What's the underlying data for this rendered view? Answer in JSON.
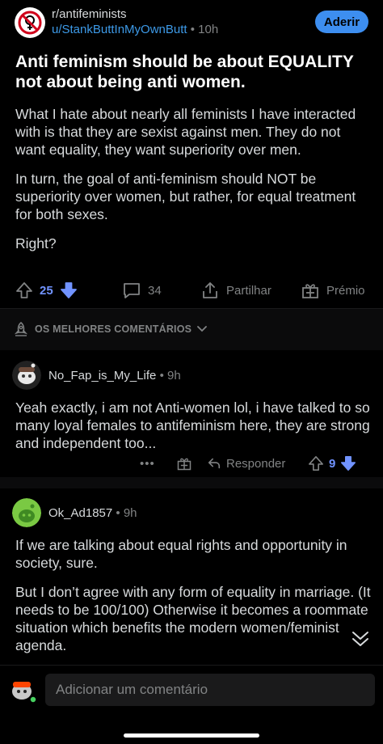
{
  "header": {
    "subreddit": "r/antifeminists",
    "author": "u/StankButtInMyOwnButt",
    "separator": " • ",
    "age": "10h",
    "join_label": "Aderir",
    "sub_icon": "no-feminism-symbol-icon"
  },
  "post": {
    "title": "Anti feminism should be about EQUALITY not about being anti women.",
    "paragraphs": [
      "What I hate about nearly all feminists I have interacted with is that they are sexist against men. They do not want equality, they want superiority over men.",
      "In turn, the goal of anti-feminism should NOT be superiority over women, but rather, for equal treatment for both sexes.",
      "Right?"
    ],
    "votes": "25",
    "comments": "34",
    "share_label": "Partilhar",
    "award_label": "Prémio"
  },
  "sort": {
    "label": "OS MELHORES COMENTÁRIOS"
  },
  "comments": [
    {
      "author": "No_Fap_is_My_Life",
      "age": "9h",
      "separator": " • ",
      "text": "Yeah exactly, i am not Anti-women lol, i have talked to so many loyal females to antifeminism here, they are strong and independent too...",
      "more": "•••",
      "reply_label": "Responder",
      "votes": "9"
    },
    {
      "author": "Ok_Ad1857",
      "age": "9h",
      "separator": " • ",
      "paragraphs": [
        "If we are talking about equal rights and opportunity in society, sure.",
        "But I don’t agree with any form of equality in marriage. (It needs to be 100/100) Otherwise it becomes a roommate situation which benefits the modern women/feminist agenda."
      ]
    }
  ],
  "composer": {
    "placeholder": "Adicionar um comentário"
  },
  "colors": {
    "background": "#000000",
    "text": "#d7dadc",
    "muted": "#818384",
    "link": "#3d9ae8",
    "upvote_active": "#7193ff",
    "join_button": "#3d8ef0"
  }
}
